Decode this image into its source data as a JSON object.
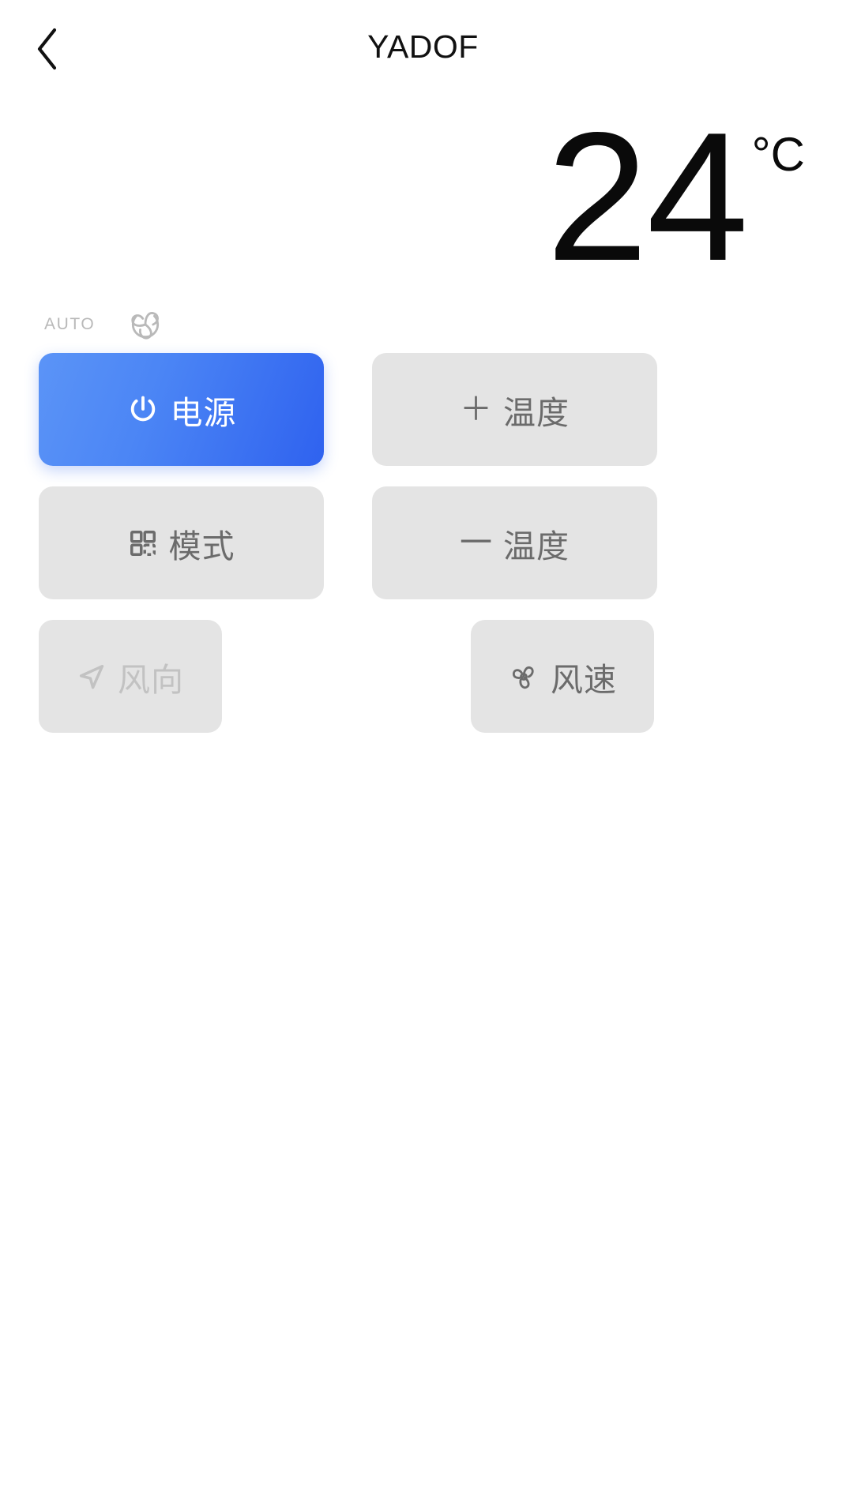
{
  "header": {
    "title": "YADOF",
    "back_icon": "chevron-left-icon"
  },
  "temperature": {
    "value": "24",
    "unit": "°C"
  },
  "status": {
    "mode_label": "AUTO",
    "fan_icon": "auto-fan-swirl-icon"
  },
  "controls": {
    "power": {
      "label": "电源",
      "icon": "power-icon",
      "state": "active",
      "accent_color": "#3a6ff0"
    },
    "temp_up": {
      "glyph": "＋",
      "label": "温度",
      "icon": "plus-icon",
      "state": "enabled"
    },
    "mode": {
      "label": "模式",
      "icon": "grid-squares-icon",
      "state": "enabled"
    },
    "temp_down": {
      "glyph": "一",
      "label": "温度",
      "icon": "minus-icon",
      "state": "enabled"
    },
    "wind_direction": {
      "label": "风向",
      "icon": "navigation-arrow-icon",
      "state": "disabled"
    },
    "fan_speed": {
      "label": "风速",
      "icon": "fan-blades-icon",
      "state": "enabled"
    }
  },
  "colors": {
    "background": "#ffffff",
    "button_grey": "#e4e4e4",
    "button_text": "#6b6b6b",
    "disabled_text": "#c2c2c2",
    "primary_start": "#5b94f7",
    "primary_end": "#2f62ef",
    "title_text": "#111111",
    "status_text": "#b9b9b9"
  }
}
